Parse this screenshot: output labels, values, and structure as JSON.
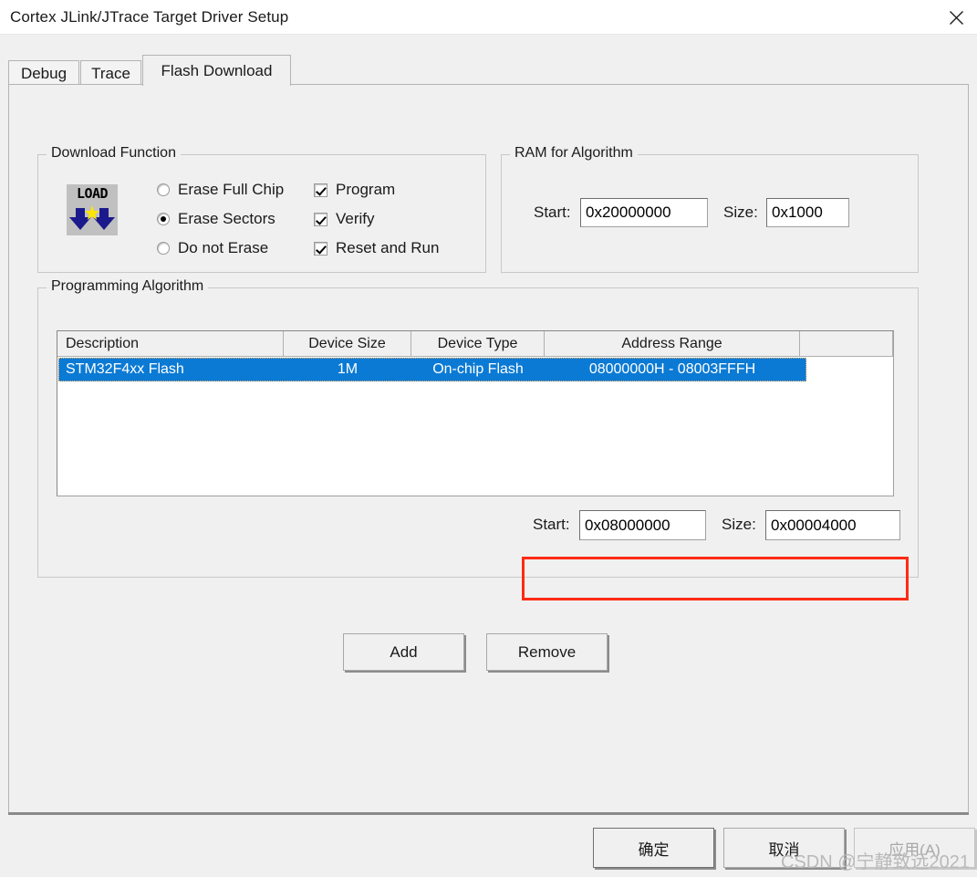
{
  "window": {
    "title": "Cortex JLink/JTrace Target Driver Setup",
    "close_icon": "close-icon"
  },
  "tabs": [
    {
      "id": "debug",
      "label": "Debug",
      "active": false
    },
    {
      "id": "trace",
      "label": "Trace",
      "active": false
    },
    {
      "id": "flash",
      "label": "Flash Download",
      "active": true
    }
  ],
  "download_function": {
    "title": "Download Function",
    "icon": {
      "name": "load-icon",
      "text": "LOAD"
    },
    "radios": [
      {
        "label": "Erase Full Chip",
        "checked": false
      },
      {
        "label": "Erase Sectors",
        "checked": true
      },
      {
        "label": "Do not Erase",
        "checked": false
      }
    ],
    "checkboxes": [
      {
        "label": "Program",
        "checked": true
      },
      {
        "label": "Verify",
        "checked": true
      },
      {
        "label": "Reset and Run",
        "checked": true
      }
    ]
  },
  "ram_for_algorithm": {
    "title": "RAM for Algorithm",
    "start_label": "Start:",
    "start_value": "0x20000000",
    "size_label": "Size:",
    "size_value": "0x1000"
  },
  "programming_algorithm": {
    "title": "Programming Algorithm",
    "columns": [
      "Description",
      "Device Size",
      "Device Type",
      "Address Range",
      ""
    ],
    "rows": [
      {
        "description": "STM32F4xx Flash",
        "device_size": "1M",
        "device_type": "On-chip Flash",
        "address_range": "08000000H - 08003FFFH",
        "selected": true
      }
    ],
    "start_label": "Start:",
    "start_value": "0x08000000",
    "size_label": "Size:",
    "size_value": "0x00004000",
    "highlight_color": "#ff2a15"
  },
  "buttons": {
    "add": "Add",
    "remove": "Remove",
    "ok": "确定",
    "cancel": "取消",
    "apply": "应用(A)"
  },
  "watermark": "CSDN @宁静致远2021",
  "colors": {
    "dialog_background": "#f0f0f0",
    "selection_blue": "#0b7ad4",
    "highlight_red": "#ff2a15",
    "icon_blue": "#1a1a8c",
    "icon_yellow": "#ffe600"
  }
}
